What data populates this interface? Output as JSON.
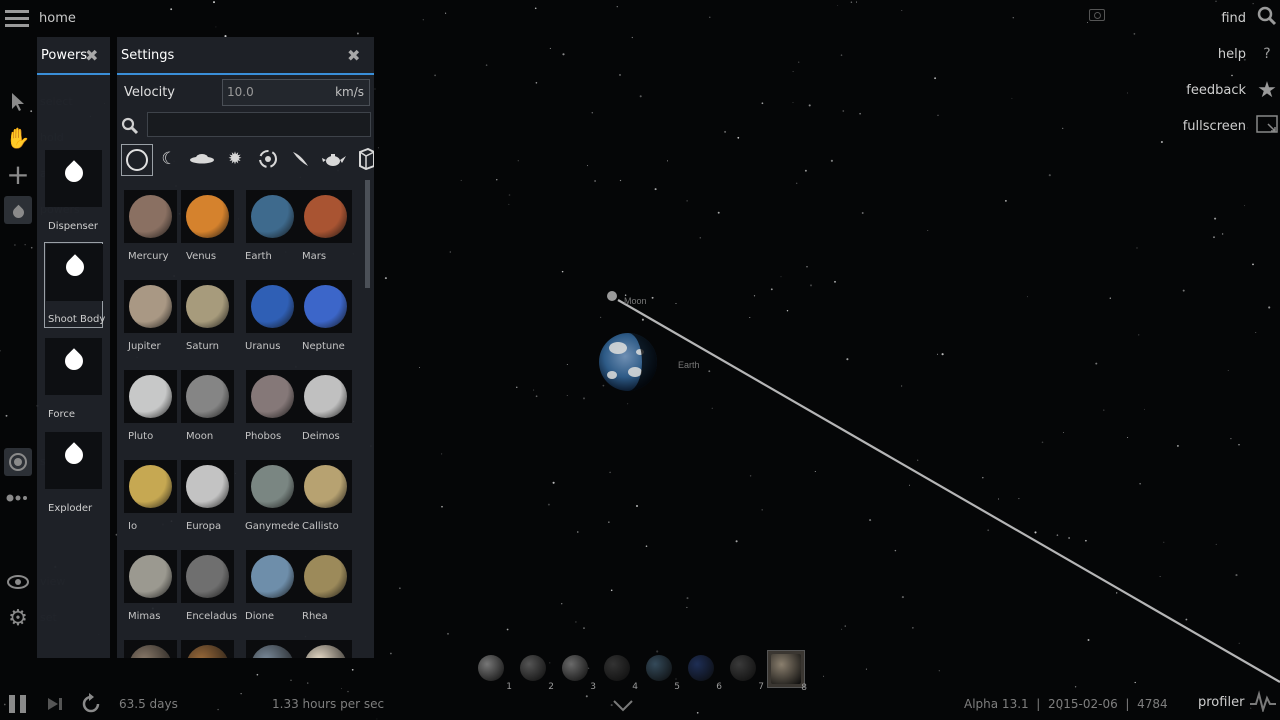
{
  "top": {
    "home_label": "home",
    "menu_icon": "hamburger-menu-icon",
    "camera_icon": "camera-icon"
  },
  "right_menu": [
    {
      "label": "find",
      "icon": "search-icon"
    },
    {
      "label": "help",
      "icon": "help-icon"
    },
    {
      "label": "feedback",
      "icon": "star-icon"
    },
    {
      "label": "fullscreen",
      "icon": "fullscreen-icon"
    }
  ],
  "left_toolbar": {
    "ghost_labels": [
      "select",
      "hold",
      "add",
      "powers",
      "sim",
      "view",
      "set"
    ]
  },
  "powers_panel": {
    "title": "Powers",
    "items": [
      {
        "label": "Dispenser"
      },
      {
        "label": "Shoot Body"
      },
      {
        "label": "Force"
      },
      {
        "label": "Exploder"
      }
    ],
    "selected": "Shoot Body"
  },
  "settings_panel": {
    "title": "Settings",
    "velocity_label": "Velocity",
    "velocity_value": "10.0",
    "velocity_unit": "km/s",
    "search_value": "",
    "categories": [
      "circle",
      "crescent",
      "saucer",
      "sun",
      "spiral",
      "comet",
      "teapot",
      "box"
    ],
    "objects": [
      {
        "label": "Mercury",
        "color": "#8a7062"
      },
      {
        "label": "Venus",
        "color": "#d5822d"
      },
      {
        "label": "Earth",
        "color": "#3e6a8d"
      },
      {
        "label": "Mars",
        "color": "#a95432"
      },
      {
        "label": "Jupiter",
        "color": "#a99884"
      },
      {
        "label": "Saturn",
        "color": "#a79b7c"
      },
      {
        "label": "Uranus",
        "color": "#2f5fb5"
      },
      {
        "label": "Neptune",
        "color": "#3c66c9"
      },
      {
        "label": "Pluto",
        "color": "#c7c8c8"
      },
      {
        "label": "Moon",
        "color": "#858585"
      },
      {
        "label": "Phobos",
        "color": "#857878"
      },
      {
        "label": "Deimos",
        "color": "#c0c0c0"
      },
      {
        "label": "Io",
        "color": "#c6a852"
      },
      {
        "label": "Europa",
        "color": "#c3c3c3"
      },
      {
        "label": "Ganymede",
        "color": "#7a8682"
      },
      {
        "label": "Callisto",
        "color": "#b7a271"
      },
      {
        "label": "Mimas",
        "color": "#9b9990"
      },
      {
        "label": "Enceladus",
        "color": "#6f6f6f"
      },
      {
        "label": "Dione",
        "color": "#6e8eaa"
      },
      {
        "label": "Rhea",
        "color": "#9c8a5a"
      }
    ]
  },
  "scene": {
    "moon_label": "Moon",
    "earth_label": "Earth"
  },
  "bottom_bar": {
    "elapsed": "63.5 days",
    "speed": "1.33 hours per sec",
    "version": "Alpha 13.1",
    "date": "2015-02-06",
    "count": "4784",
    "profiler": "profiler",
    "bodies": [
      {
        "num": "1",
        "color": "#777"
      },
      {
        "num": "2",
        "color": "#555"
      },
      {
        "num": "3",
        "color": "#6a6a6a"
      },
      {
        "num": "4",
        "color": "#333"
      },
      {
        "num": "5",
        "color": "#344a5a"
      },
      {
        "num": "6",
        "color": "#1e2e55"
      },
      {
        "num": "7",
        "color": "#3a3a3a"
      },
      {
        "num": "8",
        "color": "#8a7f6e"
      }
    ]
  },
  "colors": {
    "accent": "#3a8fd9",
    "panel": "#20242a"
  }
}
